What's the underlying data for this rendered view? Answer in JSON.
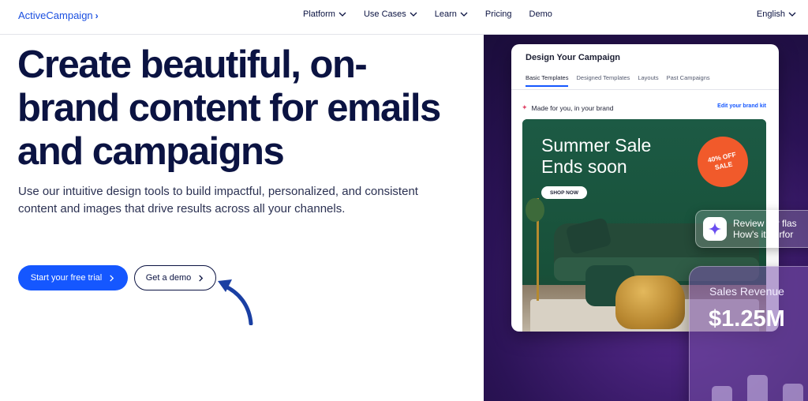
{
  "nav": {
    "logo": "ActiveCampaign",
    "items": [
      {
        "label": "Platform",
        "dropdown": true
      },
      {
        "label": "Use Cases",
        "dropdown": true
      },
      {
        "label": "Learn",
        "dropdown": true
      },
      {
        "label": "Pricing",
        "dropdown": false
      },
      {
        "label": "Demo",
        "dropdown": false
      }
    ],
    "language": "English"
  },
  "hero": {
    "title": "Create beautiful, on-brand content for emails and campaigns",
    "subtitle": "Use our intuitive design tools to build impactful, personalized, and consistent content and images that drive results across all your channels.",
    "primary_cta": "Start your free trial",
    "secondary_cta": "Get a demo"
  },
  "preview": {
    "card_title": "Design Your Campaign",
    "tabs": [
      "Basic Templates",
      "Designed Templates",
      "Layouts",
      "Past Campaigns"
    ],
    "active_tab": 0,
    "made_for_you": "Made for you, in your brand",
    "edit_link": "Edit your brand kit",
    "promo_title_line1": "Summer Sale",
    "promo_title_line2": "Ends soon",
    "shop_button": "SHOP NOW",
    "badge_line1": "40% OFF",
    "badge_line2": "SALE",
    "review_line1": "Review my flas",
    "review_line2": "How's it perfor",
    "sales_label": "Sales Revenue",
    "sales_value": "$1.25M",
    "sales_bars": [
      0.55,
      0.75,
      0.6
    ]
  },
  "colors": {
    "brand_blue": "#1557ff",
    "navy": "#0b1342",
    "badge_orange": "#f15a2b",
    "panel_purple": "#2b1356"
  }
}
